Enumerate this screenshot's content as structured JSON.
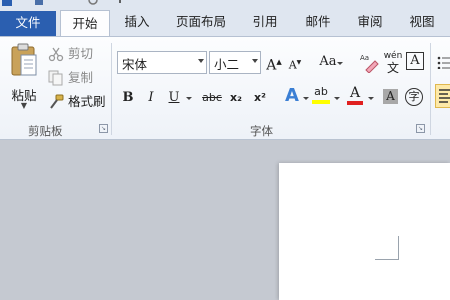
{
  "tabs": [
    {
      "label": "文件"
    },
    {
      "label": "开始"
    },
    {
      "label": "插入"
    },
    {
      "label": "页面布局"
    },
    {
      "label": "引用"
    },
    {
      "label": "邮件"
    },
    {
      "label": "审阅"
    },
    {
      "label": "视图"
    }
  ],
  "clipboard": {
    "paste_label": "粘贴",
    "cut_label": "剪切",
    "copy_label": "复制",
    "format_painter_label": "格式刷",
    "group_label": "剪贴板"
  },
  "font": {
    "font_name": "宋体",
    "font_size": "小二",
    "group_label": "字体",
    "grow_label": "A",
    "shrink_label": "A",
    "change_case_label": "Aa",
    "phonetic_label": "wén",
    "border_label": "A",
    "bold_label": "B",
    "italic_label": "I",
    "underline_label": "U",
    "strike_label": "abc",
    "subscript_label": "x₂",
    "superscript_label": "x²",
    "text_effect_label": "A",
    "highlight_label": "ab",
    "font_color_label": "A",
    "shading_label": "A",
    "enclose_label": "字"
  },
  "colors": {
    "file_tab": "#2b5fb0",
    "highlight": "#ffff00",
    "font_color": "#e02020",
    "text_effect": "#3b7fd4"
  }
}
